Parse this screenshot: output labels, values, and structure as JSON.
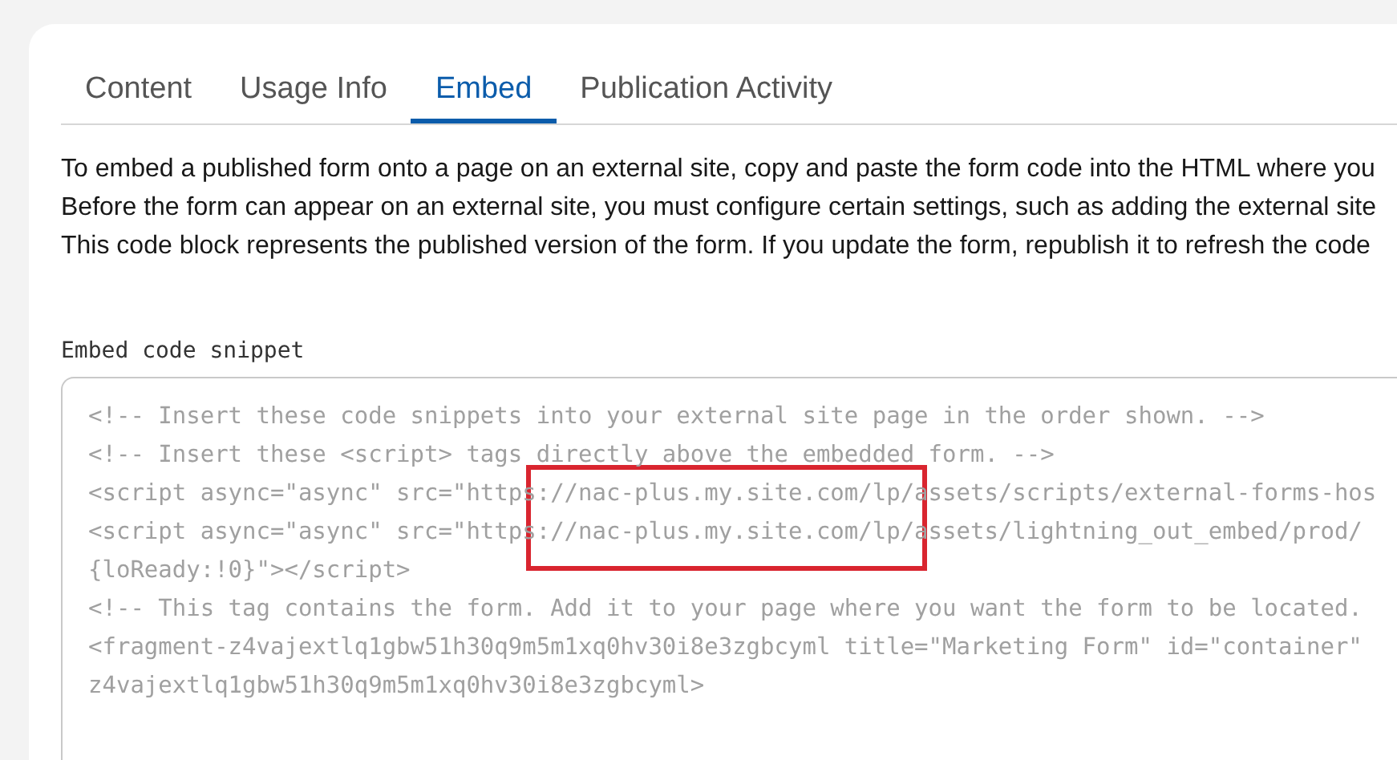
{
  "tabs": [
    {
      "label": "Content",
      "selected": false
    },
    {
      "label": "Usage Info",
      "selected": false
    },
    {
      "label": "Embed",
      "selected": true
    },
    {
      "label": "Publication Activity",
      "selected": false
    }
  ],
  "description": [
    "To embed a published form onto a page on an external site, copy and paste the form code into the HTML where you",
    "Before the form can appear on an external site, you must configure certain settings, such as adding the external site",
    "This code block represents the published version of the form. If you update the form, republish it to refresh the code"
  ],
  "embed_code": {
    "label": "Embed code snippet",
    "lines": [
      "<!-- Insert these code snippets into your external site page in the order shown. -->",
      "<!-- Insert these <script> tags directly above the embedded form. -->",
      "<script async=\"async\" src=\"https://nac-plus.my.site.com/lp/assets/scripts/external-forms-hos",
      "<script async=\"async\" src=\"https://nac-plus.my.site.com/lp/assets/lightning_out_embed/prod/",
      "{loReady:!0}\"></script>",
      "<!-- This tag contains the form. Add it to your page where you want the form to be located.",
      "<fragment-z4vajextlq1gbw51h30q9m5m1xq0hv30i8e3zgbcyml title=\"Marketing Form\" id=\"container\"",
      "z4vajextlq1gbw51h30q9m5m1xq0hv30i8e3zgbcyml>"
    ]
  }
}
